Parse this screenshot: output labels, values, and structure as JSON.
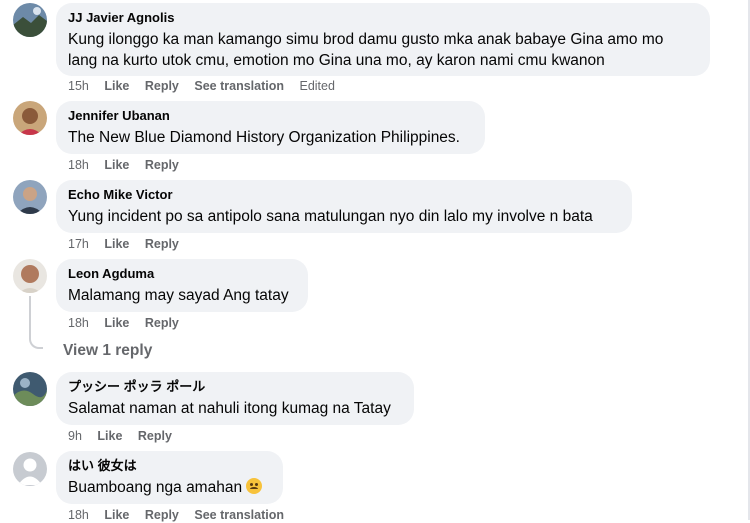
{
  "comments": [
    {
      "author": "JJ Javier Agnolis",
      "text_lines": [
        "Kung ilonggo ka man kamango simu brod damu gusto mka anak babaye Gina amo mo",
        "lang na kurto utok cmu, emotion mo Gina una mo, ay karon nami cmu kwanon"
      ],
      "time": "15h",
      "like": "Like",
      "reply": "Reply",
      "extra1": "See translation",
      "extra2": "Edited"
    },
    {
      "author": "Jennifer Ubanan",
      "text": "The New Blue Diamond History Organization Philippines.",
      "time": "18h",
      "like": "Like",
      "reply": "Reply"
    },
    {
      "author": "Echo Mike Victor",
      "text": "Yung incident po sa antipolo sana matulungan nyo din lalo my involve n bata",
      "time": "17h",
      "like": "Like",
      "reply": "Reply"
    },
    {
      "author": "Leon Agduma",
      "text": "Malamang may sayad Ang tatay",
      "time": "18h",
      "like": "Like",
      "reply": "Reply",
      "view_replies": "View 1 reply"
    },
    {
      "author": "プッシー ポッラ ポール",
      "text": "Salamat naman at nahuli itong kumag na Tatay",
      "time": "9h",
      "like": "Like",
      "reply": "Reply"
    },
    {
      "author": "はい 彼女は",
      "text": "Buamboang nga amahan",
      "emoji": "upside-down-smile-emoji",
      "time": "18h",
      "like": "Like",
      "reply": "Reply",
      "extra1": "See translation"
    }
  ],
  "colors": {
    "bubble": "#f0f2f5",
    "meta": "#65676b",
    "text": "#050505"
  }
}
